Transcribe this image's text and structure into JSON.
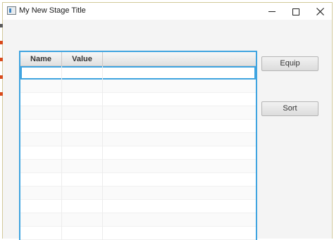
{
  "window": {
    "title": "My New Stage Title",
    "icon": "app-window-icon",
    "controls": [
      "minimize-icon",
      "maximize-icon",
      "close-icon"
    ]
  },
  "table": {
    "columns": [
      "Name",
      "Value",
      ""
    ],
    "rows": 13,
    "selected_row": 0,
    "accent": "#3fa4e0"
  },
  "buttons": {
    "equip_label": "Equip",
    "sort_label": "Sort"
  },
  "colors": {
    "side_mark_1": "#5a5a5a",
    "side_mark_2": "#d84a1b",
    "side_mark_3": "#d84a1b",
    "side_mark_4": "#d84a1b",
    "side_mark_5": "#d84a1b"
  }
}
